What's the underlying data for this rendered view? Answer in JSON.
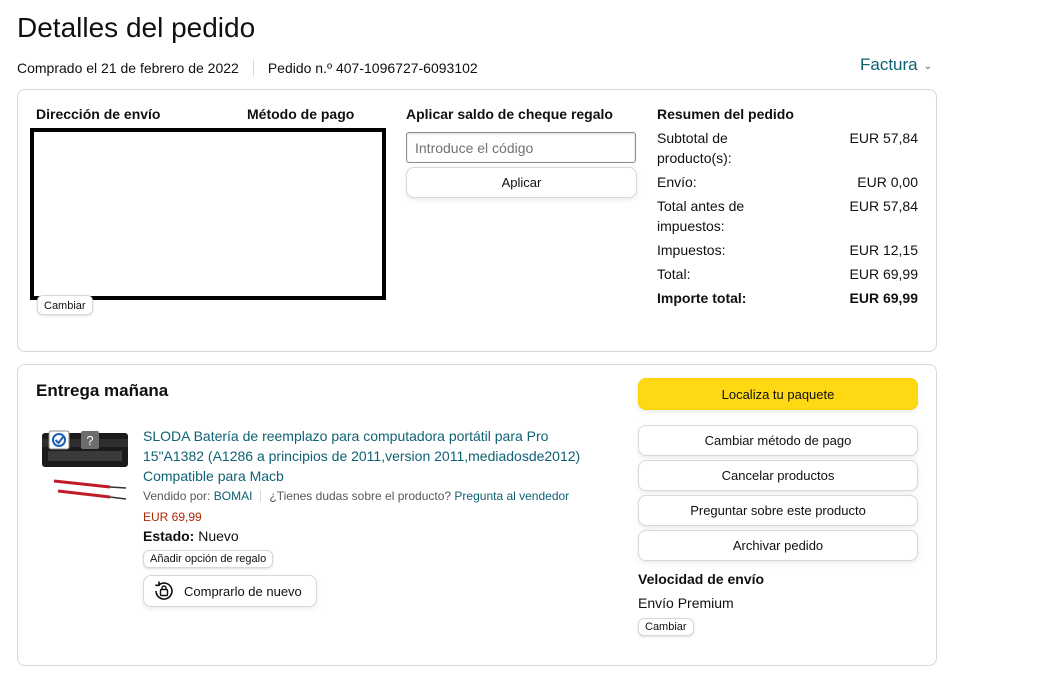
{
  "page": {
    "title": "Detalles del pedido",
    "ordered_date": "Comprado el 21 de febrero de 2022",
    "order_number": "Pedido n.º 407-1096727-6093102",
    "invoice_label": "Factura"
  },
  "info": {
    "shipping_title": "Dirección de envío",
    "payment_title": "Método de pago",
    "change_label": "Cambiar",
    "gift_title": "Aplicar saldo de cheque regalo",
    "gift_placeholder": "Introduce el código",
    "apply_label": "Aplicar"
  },
  "summary": {
    "title": "Resumen del pedido",
    "rows": [
      {
        "label": "Subtotal de producto(s):",
        "value": "EUR 57,84"
      },
      {
        "label": "Envío:",
        "value": "EUR 0,00"
      },
      {
        "label": "Total antes de impuestos:",
        "value": "EUR 57,84"
      },
      {
        "label": "Impuestos:",
        "value": "EUR 12,15"
      },
      {
        "label": "Total:",
        "value": "EUR 69,99"
      }
    ],
    "grand_total_label": "Importe total:",
    "grand_total_value": "EUR 69,99"
  },
  "delivery": {
    "title": "Entrega mañana",
    "track_label": "Localiza tu paquete",
    "actions": [
      "Cambiar método de pago",
      "Cancelar productos",
      "Preguntar sobre este producto",
      "Archivar pedido"
    ],
    "product_title": "SLODA Batería de reemplazo para computadora portátil para Pro 15\"A1382 (A1286 a principios de 2011,version 2011,mediadosde2012) Compatible para Macb",
    "sold_by_label": "Vendido por:",
    "seller": "BOMAI",
    "question": "¿Tienes dudas sobre el producto?",
    "ask_seller": "Pregunta al vendedor",
    "price": "EUR 69,99",
    "condition_label": "Estado:",
    "condition_value": "Nuevo",
    "gift_option_label": "Añadir opción de regalo",
    "rebuy_label": "Comprarlo de nuevo",
    "speed_title": "Velocidad de envío",
    "speed_value": "Envío Premium",
    "speed_change_label": "Cambiar"
  },
  "colors": {
    "link": "#0f6173",
    "price": "#b12704",
    "primary_button": "#ffd814"
  }
}
